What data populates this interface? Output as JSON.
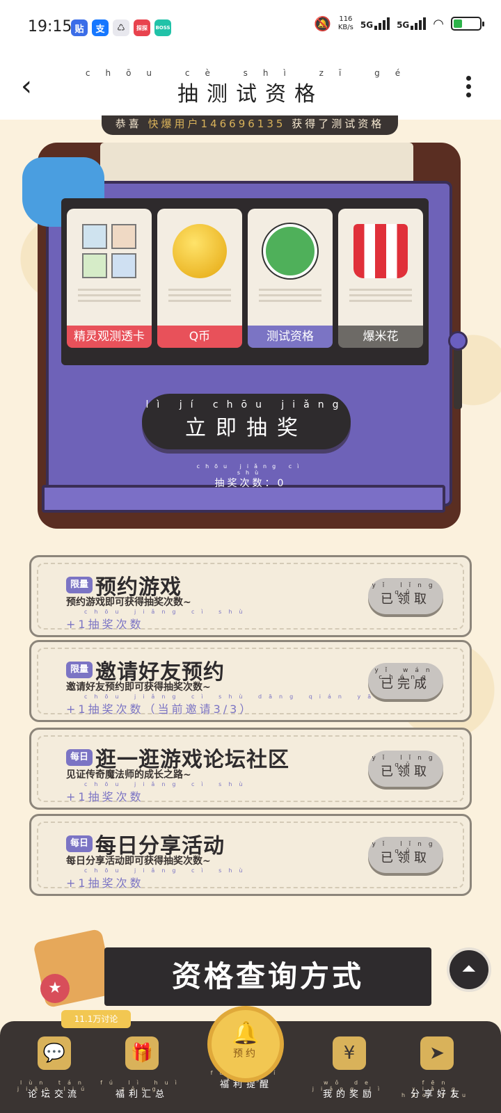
{
  "status_bar": {
    "time": "19:15",
    "apps": [
      {
        "label": "贴",
        "color": "#3b6de8"
      },
      {
        "label": "支",
        "color": "#1677ff"
      },
      {
        "label": "♺",
        "color": "#e8e8ee"
      },
      {
        "label": "探探",
        "color": "#e8434e"
      },
      {
        "label": "BOSS",
        "color": "#21c2a8"
      }
    ],
    "speed": "116",
    "speed_unit": "KB/s",
    "network_1": "5G",
    "network_2": "5G",
    "battery": "10"
  },
  "nav": {
    "back_icon": "‹",
    "title": "抽测试资格",
    "title_pinyin": "chōu cè shì zī gé"
  },
  "banner": {
    "prefix": "恭喜",
    "highlight": "快爆用户146696135",
    "suffix": "获得了测试资格"
  },
  "prizes": [
    {
      "label": "精灵观测透卡",
      "color": "#e8515a"
    },
    {
      "label": "Q币",
      "color": "#e8515a"
    },
    {
      "label": "测试资格",
      "color": "#7b74c4"
    },
    {
      "label": "爆米花",
      "color": "#6d6a66"
    }
  ],
  "draw": {
    "button_pinyin": "lì jí chōu jiǎng",
    "button_label": "立即抽奖",
    "count_pinyin": "chōu jiǎng cì shù",
    "count_label": "抽奖次数：0"
  },
  "tasks": [
    {
      "tag": "限量",
      "title": "预约游戏",
      "desc": "预约游戏即可获得抽奖次数~",
      "extra_pinyin": "chōu jiǎng cì shù",
      "extra": "+1抽奖次数",
      "button_pinyin": "yǐ lǐng qǔ",
      "button": "已领取"
    },
    {
      "tag": "限量",
      "title": "邀请好友预约",
      "desc": "邀请好友预约即可获得抽奖次数~",
      "extra_pinyin": "chōu jiǎng cì shù dāng qián yāo qǐng",
      "extra": "+1抽奖次数（当前邀请3/3）",
      "button_pinyin": "yǐ wán chéng",
      "button": "已完成"
    },
    {
      "tag": "每日",
      "title": "逛一逛游戏论坛社区",
      "desc": "见证传奇魔法师的成长之路~",
      "extra_pinyin": "chōu jiǎng cì shù",
      "extra": "+1抽奖次数",
      "button_pinyin": "yǐ lǐng qǔ",
      "button": "已领取"
    },
    {
      "tag": "每日",
      "title": "每日分享活动",
      "desc": "每日分享活动即可获得抽奖次数~",
      "extra_pinyin": "chōu jiǎng cì shù",
      "extra": "+1抽奖次数",
      "button_pinyin": "yǐ lǐng qǔ",
      "button": "已领取"
    }
  ],
  "query": {
    "title": "资格查询方式"
  },
  "bottom_nav": {
    "bubble": "11.1万讨论",
    "center_pinyin": "yù yuē",
    "center_label": "预约",
    "items": [
      {
        "pinyin": "lùn tán jiāo liú",
        "label": "论坛交流",
        "icon": "💬"
      },
      {
        "pinyin": "fú lì huì zǒng",
        "label": "福利汇总",
        "icon": "🎁"
      },
      {
        "pinyin": "fú lì tí xǐng",
        "label": "福利提醒",
        "icon": ""
      },
      {
        "pinyin": "wǒ de jiǎng lì",
        "label": "我的奖励",
        "icon": "¥"
      },
      {
        "pinyin": "fēn xiǎng hǎo yǒu",
        "label": "分享好友",
        "icon": "➤"
      }
    ]
  }
}
